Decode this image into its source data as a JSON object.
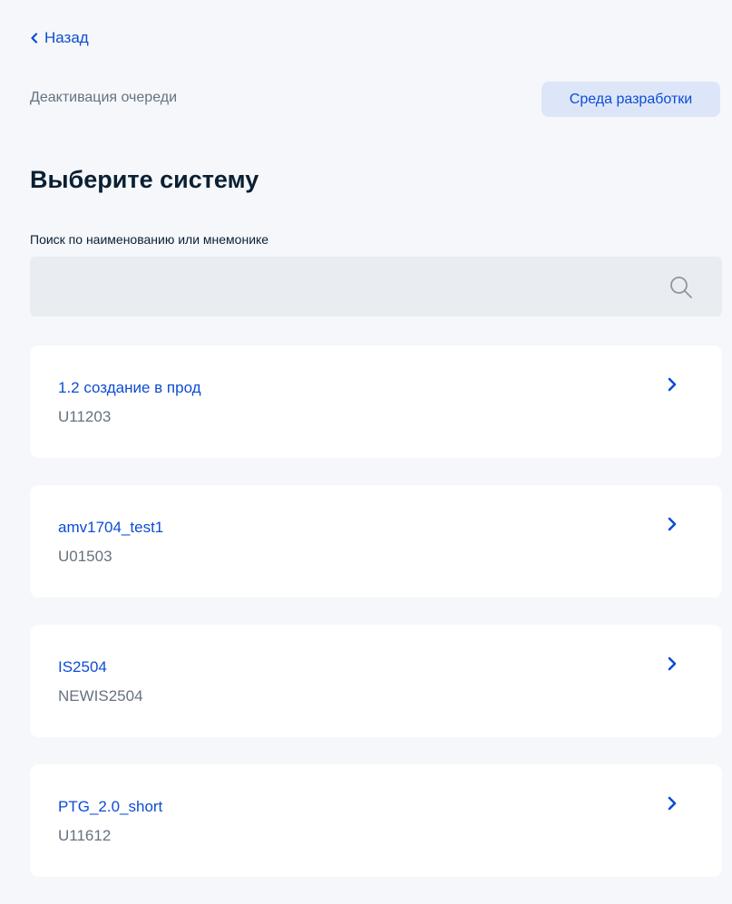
{
  "nav": {
    "back_label": "Назад"
  },
  "header": {
    "subtitle": "Деактивация очереди",
    "environment_badge": "Среда разработки"
  },
  "main": {
    "title": "Выберите систему",
    "search": {
      "label": "Поиск по наименованию или мнемонике",
      "value": "",
      "placeholder": ""
    },
    "systems": [
      {
        "name": "1.2 создание в прод",
        "code": "U11203"
      },
      {
        "name": "amv1704_test1",
        "code": "U01503"
      },
      {
        "name": "IS2504",
        "code": "NEWIS2504"
      },
      {
        "name": "PTG_2.0_short",
        "code": "U11612"
      }
    ]
  },
  "icons": {
    "back": "chevron-left-icon",
    "search": "search-icon",
    "item_arrow": "chevron-right-icon"
  },
  "colors": {
    "background": "#f5f7fa",
    "accent": "#0d4cd3",
    "badge_background": "#dce6f8",
    "search_background": "#e9edf1",
    "card_background": "#ffffff",
    "muted_text": "#66727f",
    "primary_text": "#0b1f33"
  }
}
